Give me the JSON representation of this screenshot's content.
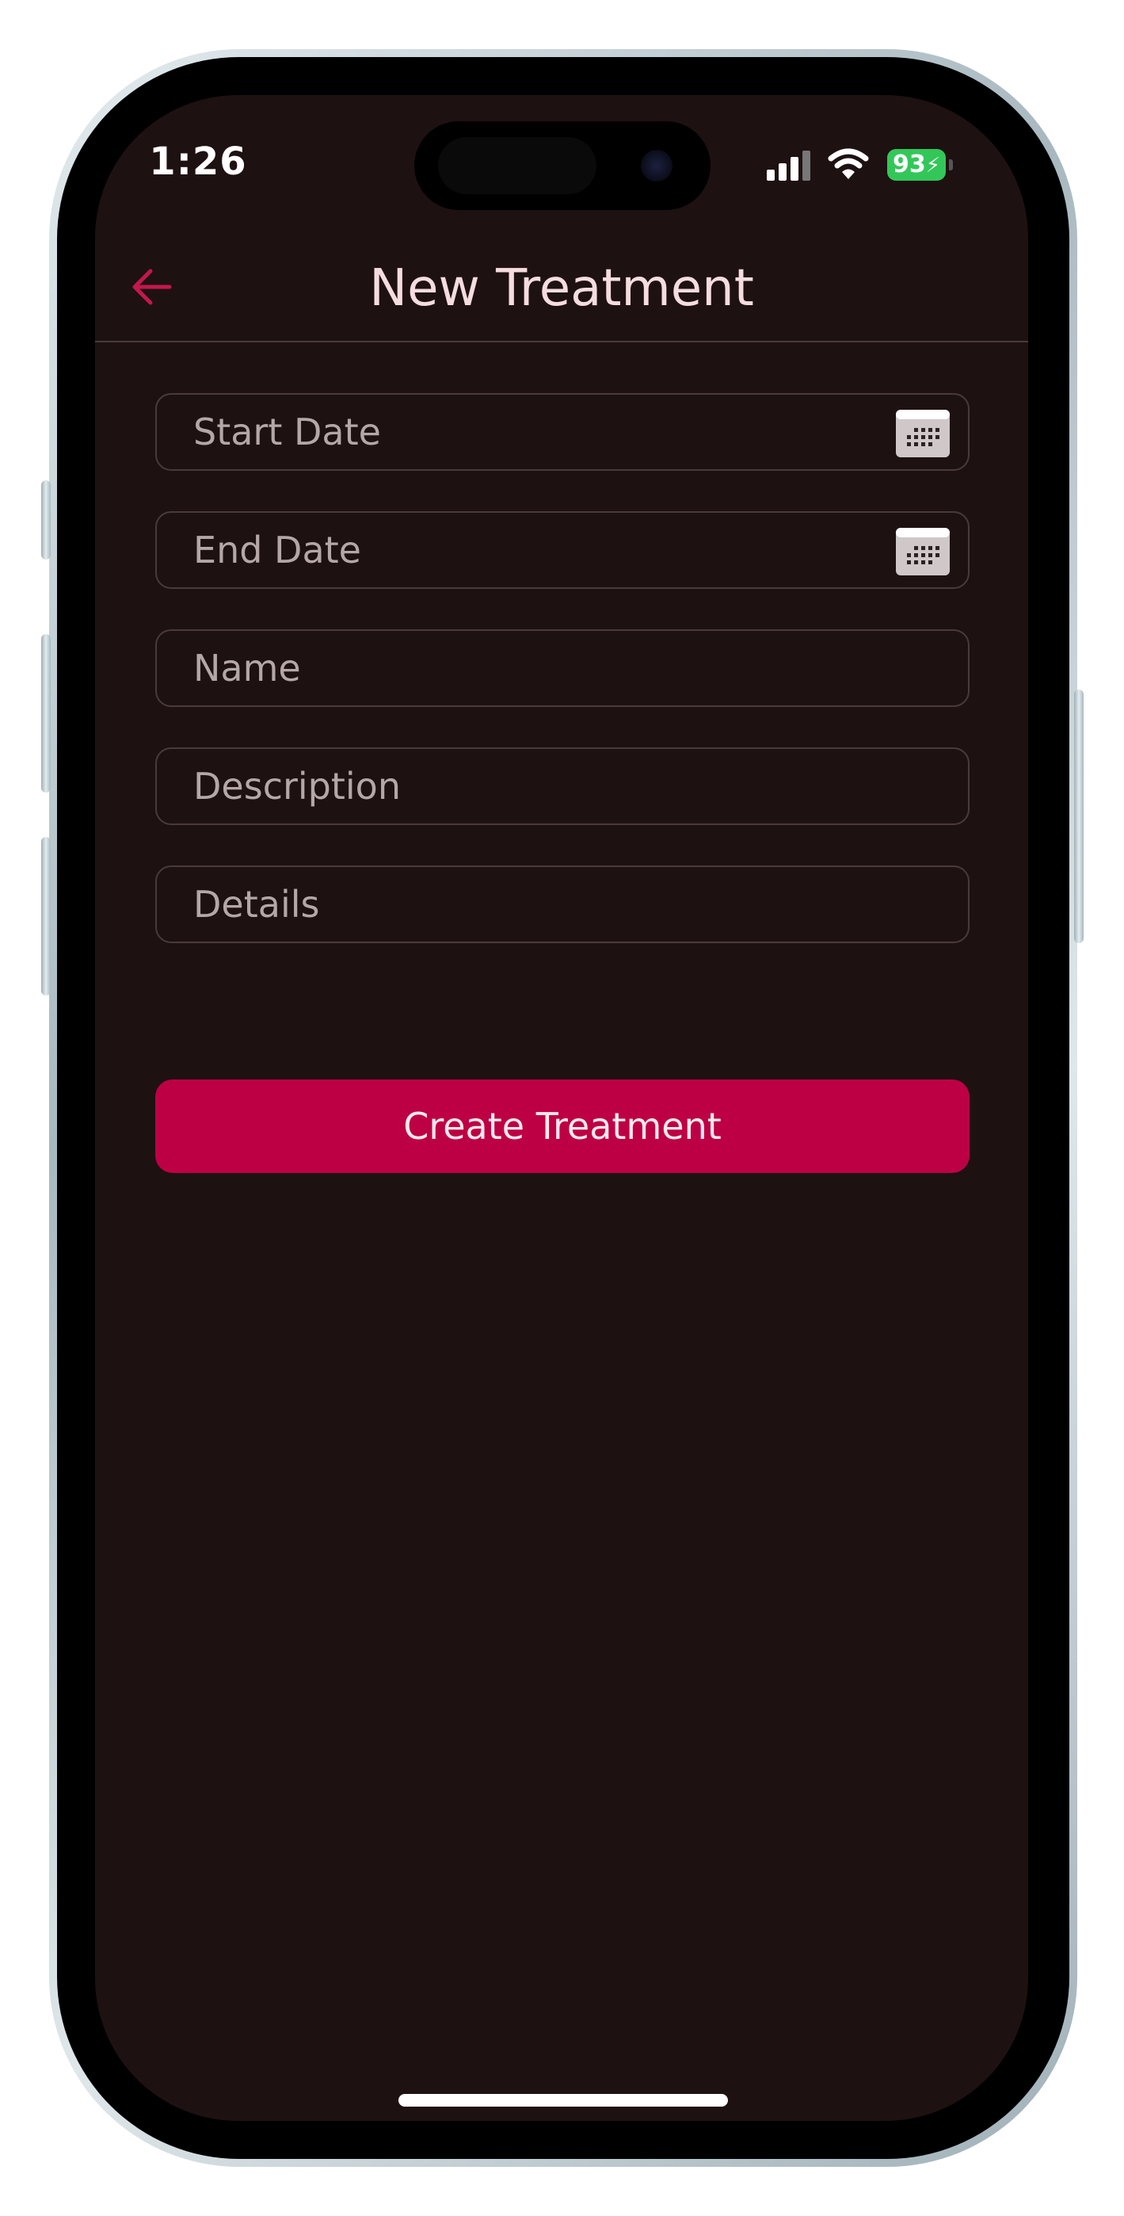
{
  "status_bar": {
    "time": "1:26",
    "battery": "93",
    "icons": [
      "signal-icon",
      "wifi-icon",
      "battery-icon"
    ]
  },
  "app_bar": {
    "title": "New Treatment",
    "back_icon": "arrow-left-icon"
  },
  "form": {
    "start_date": {
      "placeholder": "Start Date",
      "value": "",
      "icon": "calendar-icon"
    },
    "end_date": {
      "placeholder": "End Date",
      "value": "",
      "icon": "calendar-icon"
    },
    "name": {
      "placeholder": "Name",
      "value": ""
    },
    "description": {
      "placeholder": "Description",
      "value": ""
    },
    "details": {
      "placeholder": "Details",
      "value": ""
    },
    "submit_label": "Create Treatment"
  },
  "colors": {
    "background": "#1e1111",
    "accent": "#bd0044",
    "title_text": "#f5dcdf",
    "field_border": "#4a3a3b"
  }
}
